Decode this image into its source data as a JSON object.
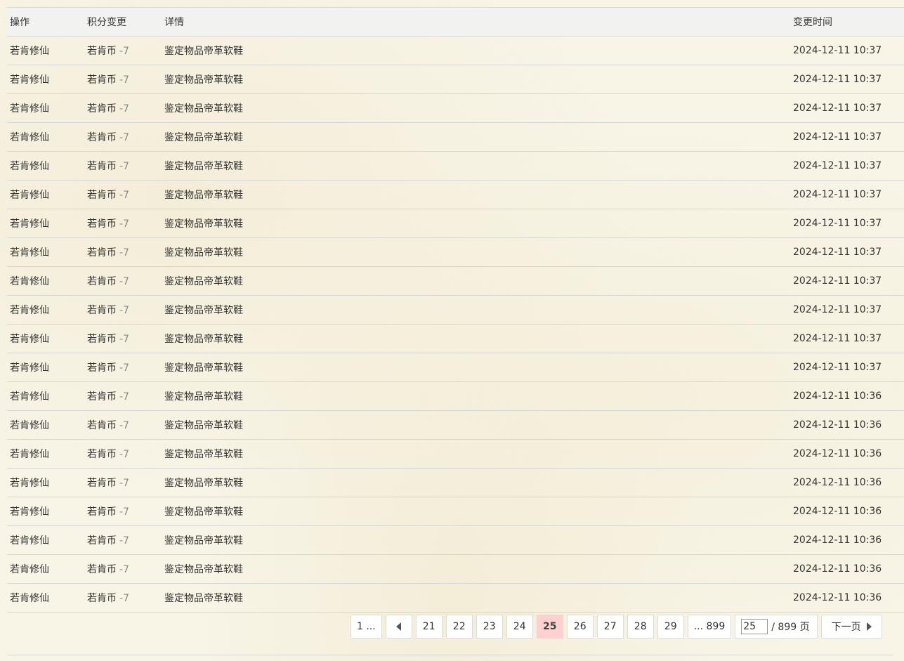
{
  "table": {
    "headers": {
      "operation": "操作",
      "credit_change": "积分变更",
      "detail": "详情",
      "time": "变更时间"
    },
    "rows": [
      {
        "operation": "若肯修仙",
        "currency": "若肯币",
        "delta": "-7",
        "detail": "鉴定物品帝革软鞋",
        "time": "2024-12-11 10:37"
      },
      {
        "operation": "若肯修仙",
        "currency": "若肯币",
        "delta": "-7",
        "detail": "鉴定物品帝革软鞋",
        "time": "2024-12-11 10:37"
      },
      {
        "operation": "若肯修仙",
        "currency": "若肯币",
        "delta": "-7",
        "detail": "鉴定物品帝革软鞋",
        "time": "2024-12-11 10:37"
      },
      {
        "operation": "若肯修仙",
        "currency": "若肯币",
        "delta": "-7",
        "detail": "鉴定物品帝革软鞋",
        "time": "2024-12-11 10:37"
      },
      {
        "operation": "若肯修仙",
        "currency": "若肯币",
        "delta": "-7",
        "detail": "鉴定物品帝革软鞋",
        "time": "2024-12-11 10:37"
      },
      {
        "operation": "若肯修仙",
        "currency": "若肯币",
        "delta": "-7",
        "detail": "鉴定物品帝革软鞋",
        "time": "2024-12-11 10:37"
      },
      {
        "operation": "若肯修仙",
        "currency": "若肯币",
        "delta": "-7",
        "detail": "鉴定物品帝革软鞋",
        "time": "2024-12-11 10:37"
      },
      {
        "operation": "若肯修仙",
        "currency": "若肯币",
        "delta": "-7",
        "detail": "鉴定物品帝革软鞋",
        "time": "2024-12-11 10:37"
      },
      {
        "operation": "若肯修仙",
        "currency": "若肯币",
        "delta": "-7",
        "detail": "鉴定物品帝革软鞋",
        "time": "2024-12-11 10:37"
      },
      {
        "operation": "若肯修仙",
        "currency": "若肯币",
        "delta": "-7",
        "detail": "鉴定物品帝革软鞋",
        "time": "2024-12-11 10:37"
      },
      {
        "operation": "若肯修仙",
        "currency": "若肯币",
        "delta": "-7",
        "detail": "鉴定物品帝革软鞋",
        "time": "2024-12-11 10:37"
      },
      {
        "operation": "若肯修仙",
        "currency": "若肯币",
        "delta": "-7",
        "detail": "鉴定物品帝革软鞋",
        "time": "2024-12-11 10:37"
      },
      {
        "operation": "若肯修仙",
        "currency": "若肯币",
        "delta": "-7",
        "detail": "鉴定物品帝革软鞋",
        "time": "2024-12-11 10:36"
      },
      {
        "operation": "若肯修仙",
        "currency": "若肯币",
        "delta": "-7",
        "detail": "鉴定物品帝革软鞋",
        "time": "2024-12-11 10:36"
      },
      {
        "operation": "若肯修仙",
        "currency": "若肯币",
        "delta": "-7",
        "detail": "鉴定物品帝革软鞋",
        "time": "2024-12-11 10:36"
      },
      {
        "operation": "若肯修仙",
        "currency": "若肯币",
        "delta": "-7",
        "detail": "鉴定物品帝革软鞋",
        "time": "2024-12-11 10:36"
      },
      {
        "operation": "若肯修仙",
        "currency": "若肯币",
        "delta": "-7",
        "detail": "鉴定物品帝革软鞋",
        "time": "2024-12-11 10:36"
      },
      {
        "operation": "若肯修仙",
        "currency": "若肯币",
        "delta": "-7",
        "detail": "鉴定物品帝革软鞋",
        "time": "2024-12-11 10:36"
      },
      {
        "operation": "若肯修仙",
        "currency": "若肯币",
        "delta": "-7",
        "detail": "鉴定物品帝革软鞋",
        "time": "2024-12-11 10:36"
      },
      {
        "operation": "若肯修仙",
        "currency": "若肯币",
        "delta": "-7",
        "detail": "鉴定物品帝革软鞋",
        "time": "2024-12-11 10:36"
      }
    ]
  },
  "pagination": {
    "first": "1 ...",
    "prev_icon": "caret-left-icon",
    "pages": [
      "21",
      "22",
      "23",
      "24",
      "25",
      "26",
      "27",
      "28",
      "29"
    ],
    "current": "25",
    "last": "... 899",
    "jump_value": "25",
    "total_text": "/ 899 页",
    "next_label": "下一页",
    "next_icon": "caret-right-icon"
  },
  "colors": {
    "background": "#f8f4e6",
    "current_page": "#ffd0d0",
    "border": "#d6d6d6",
    "delta_text": "#888888"
  }
}
